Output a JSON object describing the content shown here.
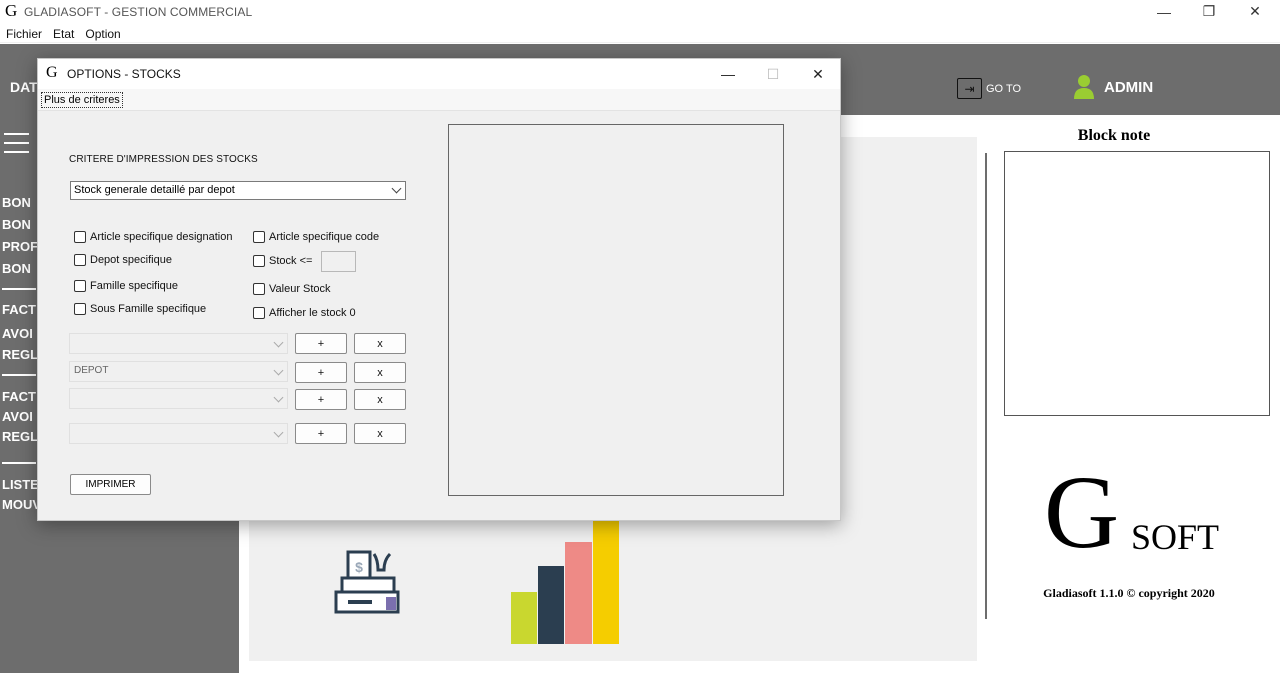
{
  "window": {
    "logo": "G",
    "title": "GLADIASOFT - GESTION COMMERCIAL",
    "minimize": "—",
    "restore": "❐",
    "close": "✕"
  },
  "menubar": {
    "items": [
      "Fichier",
      "Etat",
      "Option"
    ]
  },
  "header": {
    "left_text": "DAT",
    "goto_label": "GO TO",
    "goto_icon_glyph": "⇥",
    "user_label": "ADMIN",
    "user_icon_color": "#9acd32"
  },
  "sidebar": {
    "items": [
      "BON",
      "BON",
      "PROF",
      "BON",
      "FACT",
      "AVOI",
      "REGL",
      "FACT",
      "AVOI",
      "REGL",
      "LISTE",
      "MOUV"
    ]
  },
  "block_note": {
    "title": "Block note"
  },
  "branding": {
    "logo_big": "G",
    "logo_small": "SOFT",
    "copyright": "Gladiasoft 1.1.0 © copyright 2020"
  },
  "dialog": {
    "logo": "G",
    "title": "OPTIONS - STOCKS",
    "minimize": "—",
    "maximize": "☐",
    "close": "✕",
    "tab_label": "Plus de criteres",
    "criteria_label": "CRITERE D'IMPRESSION DES STOCKS",
    "criteria_value": "Stock generale detaillé par depot",
    "checkboxes_left": [
      "Article specifique designation",
      "Depot specifique",
      "Famille specifique",
      "Sous Famille specifique"
    ],
    "checkboxes_right": [
      "Article specifique code",
      "Stock <=",
      "Valeur Stock",
      "Afficher le stock 0"
    ],
    "combos": [
      "",
      "DEPOT",
      "",
      ""
    ],
    "add_label": "+",
    "remove_label": "x",
    "print_label": "IMPRIMER"
  },
  "chart_colors": {
    "bar1": "#c9d72f",
    "bar2": "#2b3e50",
    "bar3": "#ee8a86",
    "bar4": "#f5cd00"
  }
}
